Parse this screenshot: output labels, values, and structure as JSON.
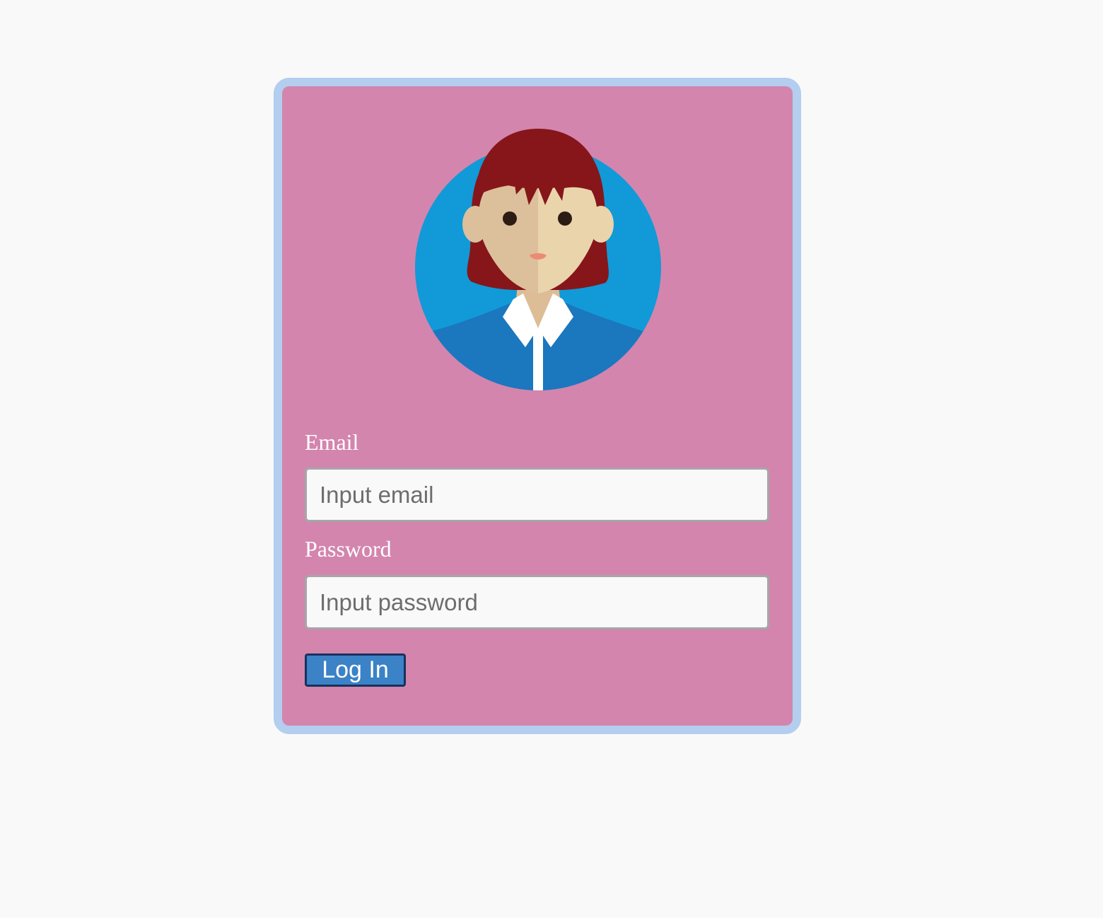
{
  "login_form": {
    "avatar_icon": "woman-avatar-icon",
    "email_label": "Email",
    "email_placeholder": "Input email",
    "email_value": "",
    "password_label": "Password",
    "password_placeholder": "Input password",
    "password_value": "",
    "login_button_label": "Log In"
  },
  "colors": {
    "page_background": "#f9f9f9",
    "card_background": "#d385ae",
    "card_border": "#b3ceee",
    "button_background": "#3b82c6",
    "button_border": "#17325d"
  }
}
